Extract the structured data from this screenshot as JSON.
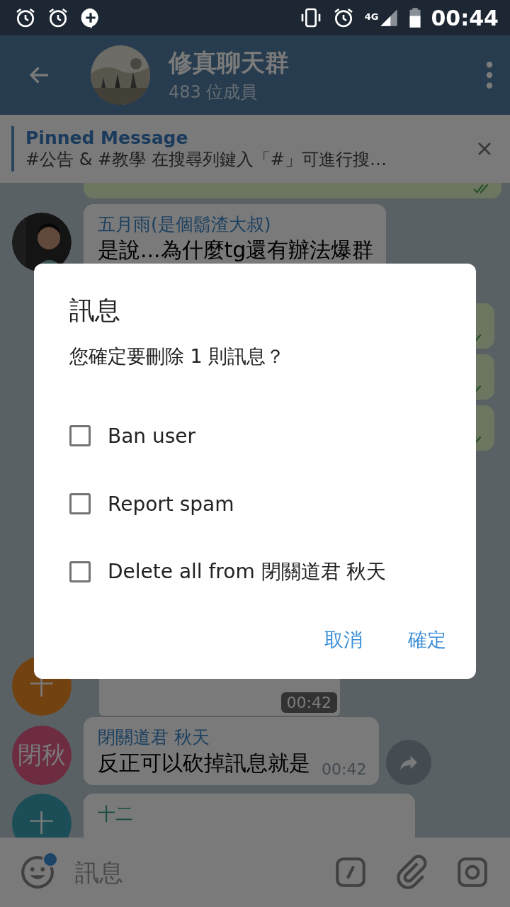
{
  "status_bar": {
    "network": "4G",
    "time": "00:44"
  },
  "header": {
    "title": "修真聊天群",
    "subtitle": "483 位成員"
  },
  "pinned": {
    "label": "Pinned Message",
    "text": "#公告 & #教學 在搜尋列鍵入「#」可進行搜…"
  },
  "messages": [
    {
      "kind": "outgoing_top"
    },
    {
      "kind": "incoming",
      "sender": "五月雨(是個鬍渣大叔)",
      "color": "#1c4060",
      "text": "是說...為什麼tg還有辦法爆群"
    },
    {
      "kind": "outgoing_stub"
    },
    {
      "kind": "outgoing_stub"
    },
    {
      "kind": "outgoing_stub"
    },
    {
      "kind": "media",
      "time": "00:42",
      "avatar": {
        "kind": "initials",
        "text": "十",
        "color": "#734211"
      }
    },
    {
      "kind": "incoming",
      "sender": "閉關道君 秋天",
      "color": "#1c4060",
      "text": "反正可以砍掉訊息就是",
      "time": "00:42",
      "share": true,
      "avatar": {
        "kind": "initials",
        "text": "閉秋",
        "color": "#6d2c40"
      }
    },
    {
      "kind": "incoming_top",
      "sender": "十二",
      "color": "#164c42",
      "avatar": {
        "kind": "initials",
        "text": "十",
        "color": "#1c4e58"
      }
    }
  ],
  "input": {
    "placeholder": "訊息",
    "emoji_badge": true
  },
  "dialog": {
    "title": "訊息",
    "message": "您確定要刪除 1 則訊息？",
    "options": [
      {
        "label": "Ban user",
        "checked": false
      },
      {
        "label": "Report spam",
        "checked": false
      },
      {
        "label": "Delete all from 閉關道君 秋天",
        "checked": false
      }
    ],
    "buttons": [
      "取消",
      "確定"
    ]
  }
}
